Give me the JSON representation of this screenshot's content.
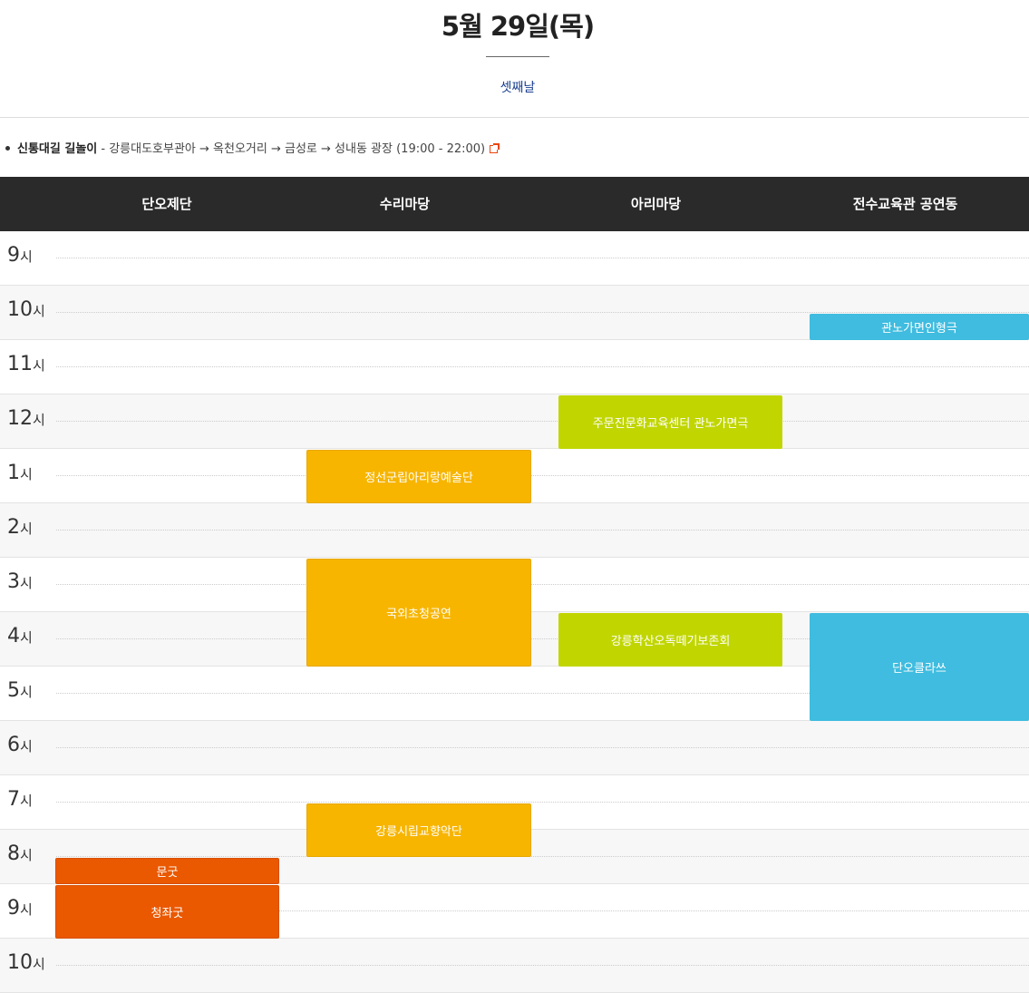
{
  "page": {
    "title": "5월 29일(목)",
    "subtitle": "셋째날"
  },
  "note": {
    "label": "신통대길 길놀이",
    "text": " - 강릉대도호부관아 → 옥천오거리 → 금성로 → 성내동 광장 (19:00 - 22:00)",
    "icon": "external-link-icon"
  },
  "venues": [
    "단오제단",
    "수리마당",
    "아리마당",
    "전수교육관 공연동"
  ],
  "hours": [
    "9",
    "10",
    "11",
    "12",
    "1",
    "2",
    "3",
    "4",
    "5",
    "6",
    "7",
    "8",
    "9",
    "10"
  ],
  "hour_suffix": "시",
  "events": [
    {
      "label": "관노가면인형극",
      "venue": "전수교육관 공연동",
      "color": "#3fbcdf"
    },
    {
      "label": "주문진문화교육센터 관노가면극",
      "venue": "아리마당",
      "color": "#c1d600"
    },
    {
      "label": "정선군립아리랑예술단",
      "venue": "수리마당",
      "color": "#f7b500"
    },
    {
      "label": "국외초청공연",
      "venue": "수리마당",
      "color": "#f7b500"
    },
    {
      "label": "강릉학산오독떼기보존회",
      "venue": "아리마당",
      "color": "#c1d600"
    },
    {
      "label": "단오클라쓰",
      "venue": "전수교육관 공연동",
      "color": "#3fbcdf"
    },
    {
      "label": "강릉시립교향악단",
      "venue": "수리마당",
      "color": "#f7b500"
    },
    {
      "label": "문굿",
      "venue": "단오제단",
      "color": "#ea5800"
    },
    {
      "label": "청좌굿",
      "venue": "단오제단",
      "color": "#ea5800"
    }
  ]
}
